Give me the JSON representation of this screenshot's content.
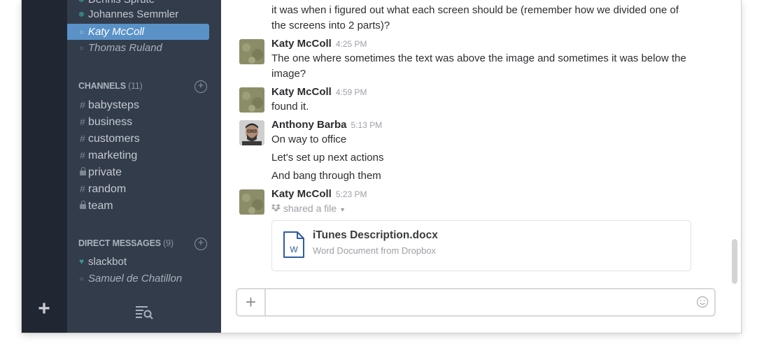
{
  "sidebar": {
    "dms_top": [
      {
        "label": "Dennis Sprute",
        "status": "online"
      },
      {
        "label": "Johannes Semmler",
        "status": "online"
      },
      {
        "label": "Katy McColl",
        "status": "active"
      },
      {
        "label": "Thomas Ruland",
        "status": "away"
      }
    ],
    "channels_header": "CHANNELS",
    "channels_count": "(11)",
    "channels": [
      {
        "label": "babysteps",
        "prefix": "#"
      },
      {
        "label": "business",
        "prefix": "#"
      },
      {
        "label": "customers",
        "prefix": "#"
      },
      {
        "label": "marketing",
        "prefix": "#"
      },
      {
        "label": "private",
        "prefix": "lock"
      },
      {
        "label": "random",
        "prefix": "#"
      },
      {
        "label": "team",
        "prefix": "lock"
      }
    ],
    "dm_header": "DIRECT MESSAGES",
    "dm_count": "(9)",
    "dms": [
      {
        "label": "slackbot",
        "status": "heart"
      },
      {
        "label": "Samuel de Chatillon",
        "status": "away"
      }
    ]
  },
  "messages": {
    "m0_text": "it was when i figured out what each screen should be (remember how we divided one of the screens into 2 parts)?",
    "m1_name": "Katy McColl",
    "m1_time": "4:25 PM",
    "m1_text": "The one where sometimes the text was above the image and sometimes it was below the image?",
    "m2_name": "Katy McColl",
    "m2_time": "4:59 PM",
    "m2_text": "found it.",
    "m3_name": "Anthony Barba",
    "m3_time": "5:13 PM",
    "m3_lines": [
      "On way to office",
      "Let's set up next actions",
      "And bang through them"
    ],
    "m4_name": "Katy McColl",
    "m4_time": "5:23 PM",
    "m4_shared": "shared a file",
    "file_title": "iTunes Description.docx",
    "file_sub": "Word Document from Dropbox",
    "file_icon_letter": "W"
  },
  "composer": {
    "placeholder": ""
  },
  "colors": {
    "rail": "#202733",
    "sidebar": "#333c4b",
    "active": "#5a92c8",
    "online": "#38978d"
  },
  "icons": {
    "team_add": "plus-icon",
    "sidebar_footer": "filter-search-icon",
    "attach": "plus-icon",
    "emoji": "smiley-icon",
    "dropbox": "dropbox-icon",
    "file": "word-document-icon"
  }
}
